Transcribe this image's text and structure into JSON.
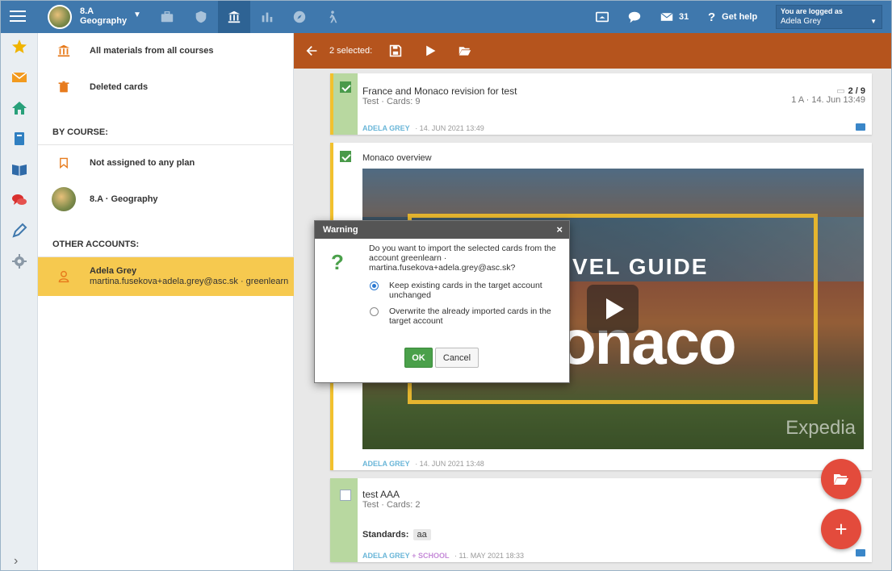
{
  "topbar": {
    "course_class": "8.A",
    "course_subject": "Geography",
    "messages_count": "31",
    "help_label": "Get help",
    "logged_in_label": "You are logged as",
    "logged_in_user": "Adela Grey"
  },
  "panel": {
    "all_materials": "All materials from all courses",
    "deleted_cards": "Deleted cards",
    "by_course_heading": "BY COURSE:",
    "not_assigned": "Not assigned to any plan",
    "course_item": "8.A · Geography",
    "other_accounts_heading": "OTHER ACCOUNTS:",
    "account_name": "Adela Grey",
    "account_detail": "martina.fusekova+adela.grey@asc.sk · greenlearn"
  },
  "actionbar": {
    "selected_label": "2 selected:"
  },
  "cards": [
    {
      "title": "France and Monaco revision for test",
      "subtitle": "Test · Cards: 9",
      "count": "2 / 9",
      "meta": "1 A · 14. Jun 13:49",
      "author": "ADELA GREY",
      "date": "· 14. JUN 2021 13:49"
    },
    {
      "title": "Monaco overview",
      "video_guide": "VEL GUIDE",
      "video_monaco": "onaco",
      "video_brand": "Expedia",
      "author": "ADELA GREY",
      "date": "· 14. JUN 2021 13:48"
    },
    {
      "title": "test AAA",
      "subtitle": "Test · Cards: 2",
      "standards_label": "Standards:",
      "standards_value": "aa",
      "author": "ADELA GREY",
      "school": "+ SCHOOL",
      "date": "· 11. MAY 2021 18:33"
    }
  ],
  "dialog": {
    "title": "Warning",
    "message": "Do you want to import the selected cards from the account greenlearn · martina.fusekova+adela.grey@asc.sk?",
    "option_keep": "Keep existing cards in the target account unchanged",
    "option_overwrite": "Overwrite the already imported cards in the target account",
    "ok_label": "OK",
    "cancel_label": "Cancel"
  },
  "colors": {
    "topbar": "#3f78ad",
    "actionbar": "#b5541d",
    "selected_account": "#f6c94f",
    "ok_button": "#4aa04a",
    "fab": "#e34b3c"
  }
}
